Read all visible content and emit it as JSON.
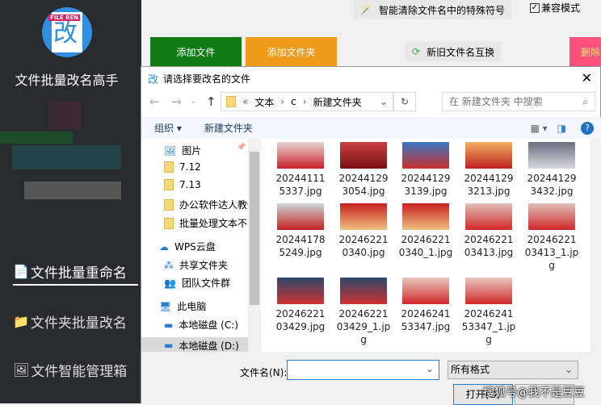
{
  "app": {
    "name": "文件批量改名高手",
    "logo_text": "FILE REN",
    "logo_char": "改"
  },
  "sidebar": {
    "items": [
      {
        "label": "文件批量重命名",
        "icon": "document-icon"
      },
      {
        "label": "文件夹批量改名",
        "icon": "folder-icon"
      },
      {
        "label": "文件智能管理箱",
        "icon": "image-tools-icon"
      }
    ]
  },
  "topbar": {
    "clean_symbols": "智能清除文件名中的特殊符号",
    "compat_mode": "兼容模式",
    "swap_names": "新旧文件名互换"
  },
  "buttons": {
    "add_file": "添加文件",
    "add_folder": "添加文件夹",
    "delete": "删除"
  },
  "colors": {
    "add_file": "#0f7d14",
    "add_folder": "#f09a1a",
    "delete": "#ff4f7c"
  },
  "dialog": {
    "title": "请选择要改名的文件",
    "path": [
      "«",
      "文本",
      "›",
      "c",
      "›",
      "新建文件夹"
    ],
    "search_placeholder": "在 新建文件夹 中搜索",
    "organize": "组织 ▾",
    "new_folder": "新建文件夹",
    "nav": [
      {
        "label": "图片",
        "icon": "pictures-icon"
      },
      {
        "label": "7.12",
        "icon": "folder-icon"
      },
      {
        "label": "7.13",
        "icon": "folder-icon"
      },
      {
        "label": "办公软件达人教他",
        "icon": "folder-icon"
      },
      {
        "label": "批量处理文本不多",
        "icon": "folder-icon"
      },
      {
        "label": "WPS云盘",
        "icon": "cloud-icon"
      },
      {
        "label": "共享文件夹",
        "icon": "share-icon"
      },
      {
        "label": "团队文件群",
        "icon": "team-icon"
      },
      {
        "label": "此电脑",
        "icon": "computer-icon"
      },
      {
        "label": "本地磁盘 (C:)",
        "icon": "drive-icon"
      },
      {
        "label": "本地磁盘 (D:)",
        "icon": "drive-icon"
      }
    ],
    "files": [
      {
        "name": "202441115337.jpg",
        "l1": "20244111",
        "l2": "5337.jpg"
      },
      {
        "name": "202441293054.jpg",
        "l1": "20244129",
        "l2": "3054.jpg"
      },
      {
        "name": "202441293139.jpg",
        "l1": "20244129",
        "l2": "3139.jpg"
      },
      {
        "name": "202441293213.jpg",
        "l1": "20244129",
        "l2": "3213.jpg"
      },
      {
        "name": "202441293432.jpg",
        "l1": "20244129",
        "l2": "3432.jpg"
      },
      {
        "name": "202441785249.jpg",
        "l1": "20244178",
        "l2": "5249.jpg"
      },
      {
        "name": "202462210340.jpg",
        "l1": "20246221",
        "l2": "0340.jpg"
      },
      {
        "name": "202462210340_1.jpg",
        "l1": "20246221",
        "l2": "0340_1.jpg"
      },
      {
        "name": "2024622103413.jpg",
        "l1": "20246221",
        "l2": "03413.jpg"
      },
      {
        "name": "2024622103413_1.jpg",
        "l1": "20246221",
        "l2": "03413_1.jp",
        "l3": "g"
      },
      {
        "name": "2024622103429.jpg",
        "l1": "20246221",
        "l2": "03429.jpg"
      },
      {
        "name": "2024622103429_1.jpg",
        "l1": "20246221",
        "l2": "03429_1.jp",
        "l3": "g"
      },
      {
        "name": "2024624153347.jpg",
        "l1": "20246241",
        "l2": "53347.jpg"
      },
      {
        "name": "2024624153347_1.jpg",
        "l1": "20246241",
        "l2": "53347_1.jp",
        "l3": "g"
      }
    ],
    "filename_label": "文件名(N):",
    "filename_value": "",
    "filetype": "所有格式",
    "open": "打开(O)",
    "cancel": "取消"
  },
  "watermark": "搜狐号@我不是豆豆"
}
